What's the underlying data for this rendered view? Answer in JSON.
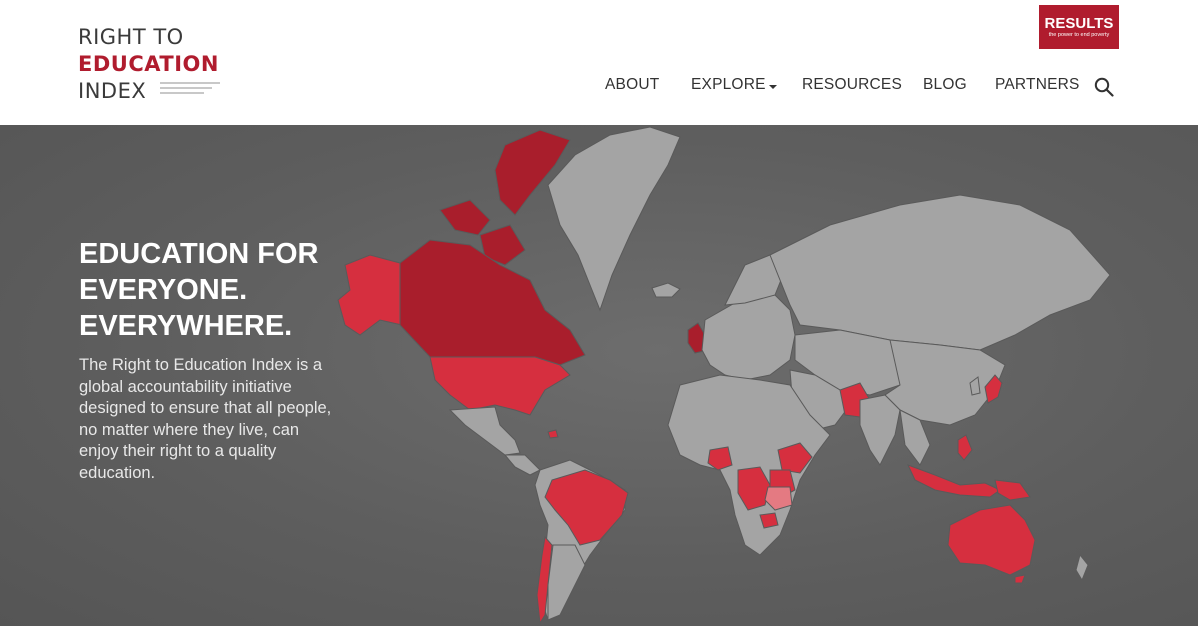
{
  "logo": {
    "line1": "RIGHT TO",
    "line2": "EDUCATION",
    "line3": "INDEX"
  },
  "partner_badge": {
    "title": "RESULTS",
    "tagline": "the power to end poverty"
  },
  "nav": {
    "items": [
      "ABOUT",
      "EXPLORE",
      "RESOURCES",
      "BLOG",
      "PARTNERS"
    ],
    "search_icon": "search-icon",
    "explore_dropdown_icon": "caret-down-icon"
  },
  "hero": {
    "title_line1": "EDUCATION FOR",
    "title_line2": "EVERYONE.",
    "title_line3": "EVERYWHERE.",
    "description": "The Right to Education Index is a global accountability initiative designed to ensure that all people, no matter where they live, can enjoy their right to a quality education."
  },
  "colors": {
    "brand_red": "#b01c2e",
    "highlight_red": "#d62f3f",
    "dark_red": "#a91e2c",
    "land_gray": "#a4a4a4",
    "background_gray": "#616161"
  }
}
